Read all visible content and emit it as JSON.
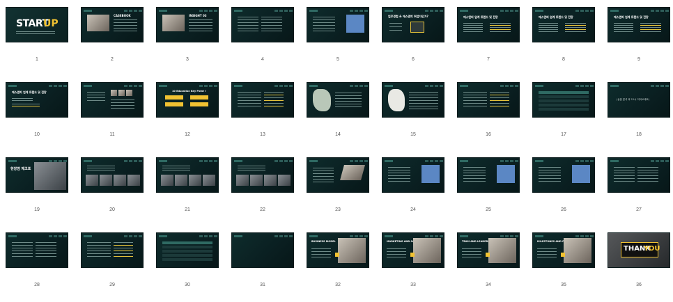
{
  "slides": [
    {
      "number": "1",
      "kind": "title",
      "title_a": "START",
      "title_b": "UP"
    },
    {
      "number": "2",
      "kind": "photo-list",
      "heading": "CASEBOOK"
    },
    {
      "number": "3",
      "kind": "photo-list",
      "heading": "INSIGHT 03"
    },
    {
      "number": "4",
      "kind": "list"
    },
    {
      "number": "5",
      "kind": "list-square"
    },
    {
      "number": "6",
      "kind": "question",
      "heading": "업무경험 & 에스앤피 취업자인가?"
    },
    {
      "number": "7",
      "kind": "heading-text",
      "heading": "에스앤피 업계 트렌드 및 전망"
    },
    {
      "number": "8",
      "kind": "heading-text",
      "heading": "에스앤피 업계 트렌드 및 전망"
    },
    {
      "number": "9",
      "kind": "heading-text",
      "heading": "에스앤피 업계 트렌드 및 전망"
    },
    {
      "number": "10",
      "kind": "heading-text-yellow",
      "heading": "에스앤피 업계 트렌드 및 전망"
    },
    {
      "number": "11",
      "kind": "icons"
    },
    {
      "number": "12",
      "kind": "boxes",
      "heading": "10 Education Key Point !"
    },
    {
      "number": "13",
      "kind": "list-yellow"
    },
    {
      "number": "14",
      "kind": "map"
    },
    {
      "number": "15",
      "kind": "map-table"
    },
    {
      "number": "16",
      "kind": "list-yellow"
    },
    {
      "number": "17",
      "kind": "table"
    },
    {
      "number": "18",
      "kind": "quote",
      "text": "(상문 분석 후 12시 이어쓰세요)"
    },
    {
      "number": "19",
      "kind": "heading-photo",
      "heading": "현장점 체크포"
    },
    {
      "number": "20",
      "kind": "photos"
    },
    {
      "number": "21",
      "kind": "photos"
    },
    {
      "number": "22",
      "kind": "photos"
    },
    {
      "number": "23",
      "kind": "floorplan"
    },
    {
      "number": "24",
      "kind": "list-square"
    },
    {
      "number": "25",
      "kind": "list-square"
    },
    {
      "number": "26",
      "kind": "list-square"
    },
    {
      "number": "27",
      "kind": "list"
    },
    {
      "number": "28",
      "kind": "list"
    },
    {
      "number": "29",
      "kind": "list-yellow"
    },
    {
      "number": "30",
      "kind": "table"
    },
    {
      "number": "31",
      "kind": "blank"
    },
    {
      "number": "32",
      "kind": "section",
      "heading": "BUSINESS MODEL"
    },
    {
      "number": "33",
      "kind": "section",
      "heading": "MARKETING AND SALES STRATEGY"
    },
    {
      "number": "34",
      "kind": "section",
      "heading": "TEAM AND LEADERSHIP"
    },
    {
      "number": "35",
      "kind": "section",
      "heading": "MILESTONES AND FUTURE PLANS"
    },
    {
      "number": "36",
      "kind": "end",
      "heading_a": "THANK",
      "heading_b": "YOU"
    }
  ],
  "colors": {
    "accent": "#f1c232",
    "bg": "#0e2c2c",
    "blue": "#5b87c4"
  }
}
